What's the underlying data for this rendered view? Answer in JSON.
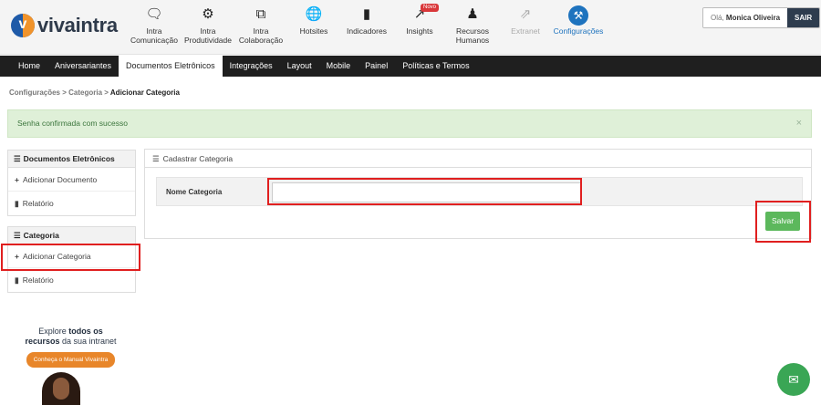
{
  "logo": {
    "text": "vivaintra",
    "mark": "v"
  },
  "top_nav": [
    {
      "label": "Intra Comunicação",
      "icon": "chat-icon"
    },
    {
      "label": "Intra Produtividade",
      "icon": "gears-icon"
    },
    {
      "label": "Intra Colaboração",
      "icon": "share-icon"
    },
    {
      "label": "Hotsites",
      "icon": "globe-icon"
    },
    {
      "label": "Indicadores",
      "icon": "signal-icon"
    },
    {
      "label": "Insights",
      "icon": "trend-icon",
      "badge": "Novo"
    },
    {
      "label": "Recursos Humanos",
      "icon": "users-icon"
    },
    {
      "label": "Extranet",
      "icon": "external-link-icon"
    },
    {
      "label": "Configurações",
      "icon": "wrench-icon"
    }
  ],
  "user": {
    "greeting": "Olá,",
    "name": "Monica Oliveira",
    "logout": "SAIR"
  },
  "menu": [
    "Home",
    "Aniversariantes",
    "Documentos Eletrônicos",
    "Integrações",
    "Layout",
    "Mobile",
    "Painel",
    "Políticas e Termos"
  ],
  "breadcrumb": {
    "part1": "Configurações",
    "sep": ">",
    "part2": "Categoria",
    "current": "Adicionar Categoria"
  },
  "alert": {
    "text": "Senha confirmada com sucesso",
    "close": "×"
  },
  "sidebar": {
    "docs": {
      "title": "Documentos Eletrônicos",
      "items": [
        "Adicionar Documento",
        "Relatório"
      ]
    },
    "categoria": {
      "title": "Categoria",
      "items": [
        "Adicionar Categoria",
        "Relatório"
      ]
    }
  },
  "panel": {
    "title": "Cadastrar Categoria",
    "field_label": "Nome Categoria",
    "field_value": "",
    "save": "Salvar"
  },
  "promo": {
    "line1": "Explore",
    "bold1": "todos os",
    "bold2": "recursos",
    "line2": "da sua intranet",
    "button": "Conheça o Manual Vivaintra"
  },
  "colors": {
    "accent": "#1e73be",
    "success": "#5cb85c",
    "highlight": "#e01f1f",
    "menubar": "#1f1f1f"
  }
}
